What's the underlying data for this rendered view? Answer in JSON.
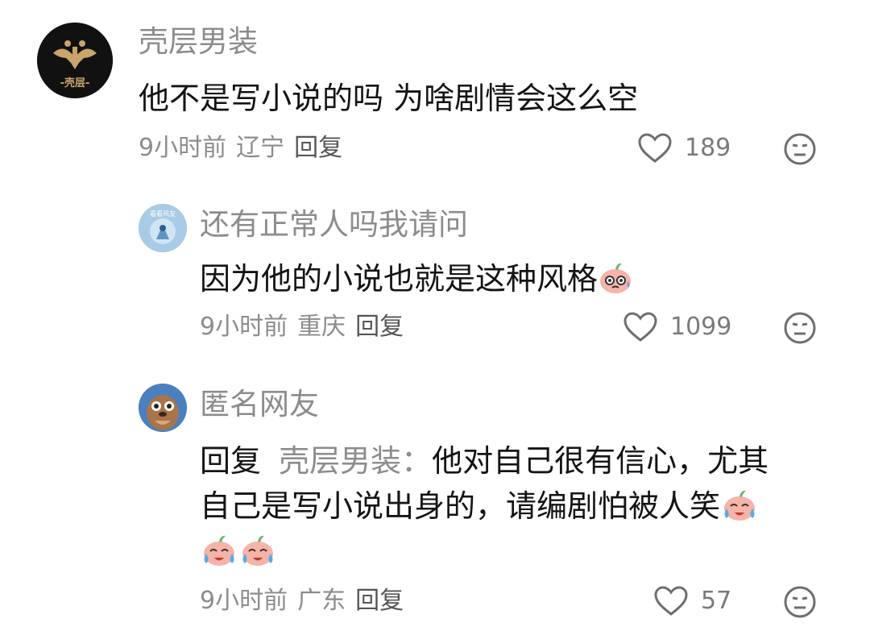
{
  "comments": [
    {
      "user": "壳层男装",
      "avatar_text": "-壳层-",
      "text": "他不是写小说的吗 为啥剧情会这么空",
      "time": "9小时前",
      "location": "辽宁",
      "reply_label": "回复",
      "likes": "189"
    }
  ],
  "replies": [
    {
      "user": "还有正常人吗我请问",
      "avatar_text": "看看风友",
      "text": "因为他的小说也就是这种风格",
      "time": "9小时前",
      "location": "重庆",
      "reply_label": "回复",
      "likes": "1099"
    },
    {
      "user": "匿名网友",
      "reply_prefix": "回复",
      "reply_to": "壳层男装：",
      "text_line1": "他对自己很有信心，尤其",
      "text_line2": "自己是写小说出身的，请编剧怕被人笑",
      "time": "9小时前",
      "location": "广东",
      "reply_label": "回复",
      "likes": "57"
    }
  ]
}
